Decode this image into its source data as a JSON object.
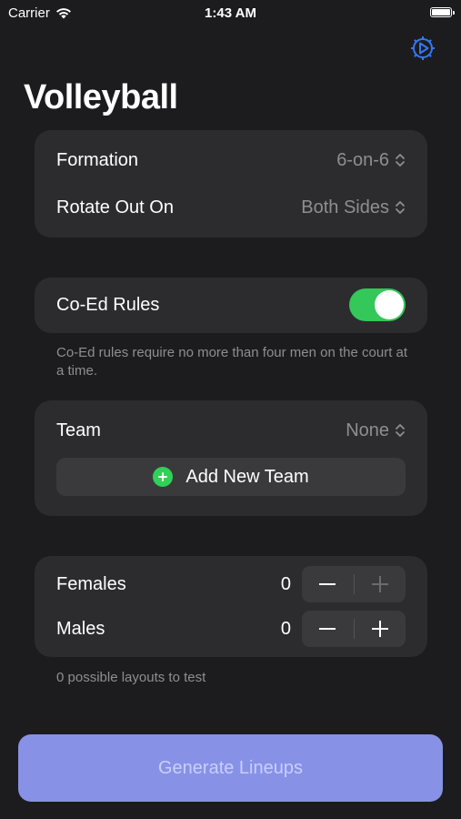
{
  "status_bar": {
    "carrier": "Carrier",
    "time": "1:43 AM"
  },
  "title": "Volleyball",
  "settings": {
    "formation_label": "Formation",
    "formation_value": "6-on-6",
    "rotate_label": "Rotate Out On",
    "rotate_value": "Both Sides"
  },
  "coed": {
    "label": "Co-Ed Rules",
    "enabled": true,
    "footnote": "Co-Ed rules require no more than four men on the court at a time."
  },
  "team": {
    "label": "Team",
    "value": "None",
    "add_button": "Add New Team"
  },
  "players": {
    "females_label": "Females",
    "females_count": "0",
    "males_label": "Males",
    "males_count": "0"
  },
  "layouts_note": "0 possible layouts to test",
  "generate_button": "Generate Lineups",
  "colors": {
    "background": "#1c1c1e",
    "card": "#2c2c2e",
    "accent_blue": "#3478f6",
    "toggle_on": "#34c759",
    "add_icon": "#30d158",
    "generate_bg": "#8792e6"
  }
}
